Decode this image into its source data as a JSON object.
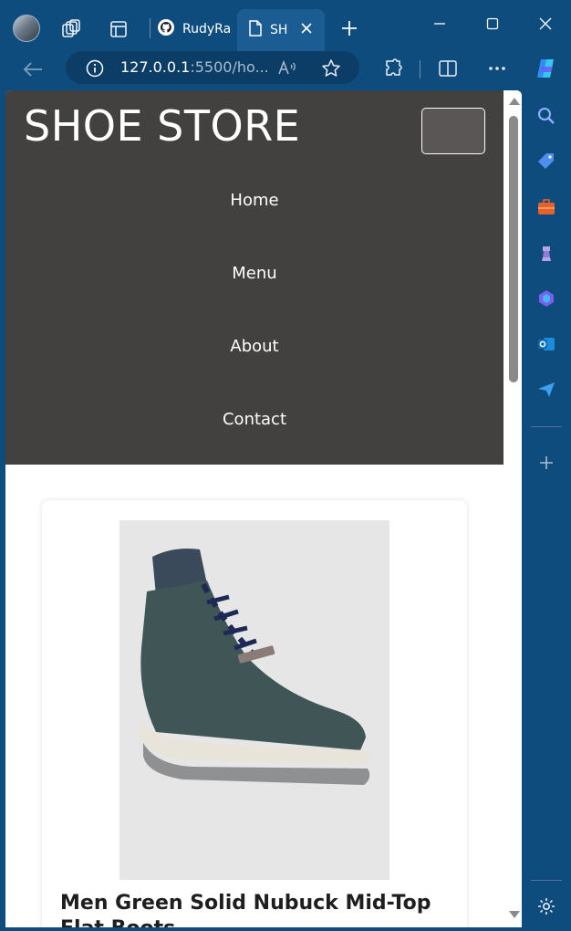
{
  "browser": {
    "tabs": [
      {
        "title": "RudyRa"
      },
      {
        "title": "SH"
      }
    ],
    "address": {
      "host": "127.0.0.1",
      "rest": ":5500/ho..."
    }
  },
  "site": {
    "brand": "SHOE STORE",
    "nav": [
      "Home",
      "Menu",
      "About",
      "Contact"
    ]
  },
  "product": {
    "title": "Men Green Solid Nubuck Mid-Top Flat Boots"
  },
  "colors": {
    "browser_chrome": "#0e4c7e",
    "header_bg": "#434040",
    "toggle_bg": "#5b5656"
  }
}
